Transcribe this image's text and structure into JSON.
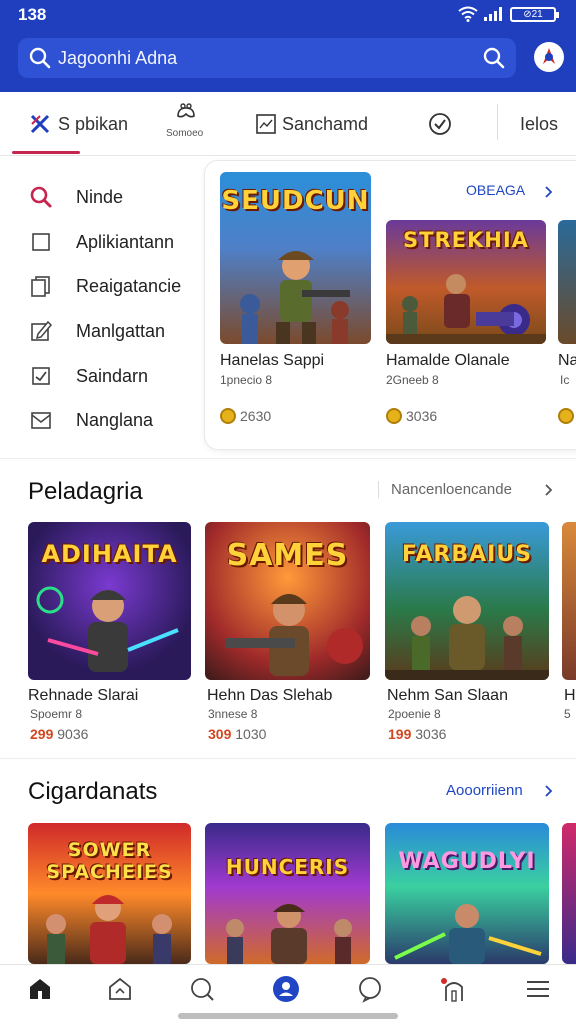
{
  "status_bar": {
    "time": "138",
    "battery": "⊘21"
  },
  "search": {
    "text": "Jagoonhi Adna",
    "left_icon": "search-icon",
    "right_icon": "search-icon"
  },
  "tabs": [
    {
      "label": "S pbikan",
      "icon": "close-x-icon",
      "active": true
    },
    {
      "label": "",
      "sublabel": "Somoeo",
      "icon": "controller-icon"
    },
    {
      "label": "Sanchamd",
      "icon": "image-icon"
    },
    {
      "label": "",
      "icon": "check-circle-icon"
    },
    {
      "label": "Ielos",
      "icon": ""
    }
  ],
  "sidebar": {
    "items": [
      {
        "label": "Ninde",
        "icon": "search-icon"
      },
      {
        "label": "Aplikiantann",
        "icon": "square-icon"
      },
      {
        "label": "Reaigatancie",
        "icon": "copy-icon"
      },
      {
        "label": "Manlgattan",
        "icon": "edit-icon"
      },
      {
        "label": "Saindarn",
        "icon": "check-square-icon"
      },
      {
        "label": "Nanglana",
        "icon": "mail-icon"
      }
    ]
  },
  "featured": {
    "link": "OBEAGA",
    "games": [
      {
        "art": "SEUDCUN",
        "name": "Hanelas Sappi",
        "sub": "1pnecio 8",
        "price": "2630"
      },
      {
        "art": "STREKHIA",
        "name": "Hamalde Olanale",
        "sub": "2Gneeb 8",
        "price": "3036"
      },
      {
        "art": "",
        "name": "Na",
        "sub": "Ic",
        "price": ""
      }
    ]
  },
  "section1": {
    "title": "Peladagria",
    "right": "Nancenloencande",
    "games": [
      {
        "art": "ADIHAITA",
        "name": "Rehnade Slarai",
        "sub": "Spoemr 8",
        "price_bold": "299",
        "price_rest": "9036"
      },
      {
        "art": "SAMES",
        "name": "Hehn Das Slehab",
        "sub": "3nnese 8",
        "price_bold": "309",
        "price_rest": "1030"
      },
      {
        "art": "FARBAIUS",
        "name": "Nehm San Slaan",
        "sub": "2poenie 8",
        "price_bold": "199",
        "price_rest": "3036"
      },
      {
        "art": "",
        "name": "H",
        "sub": "5",
        "price_bold": "",
        "price_rest": ""
      }
    ]
  },
  "section2": {
    "title": "Cigardanats",
    "right": "Aooorriienn",
    "games": [
      {
        "art": "SOWER SPACHEIES"
      },
      {
        "art": "HUNCERIS"
      },
      {
        "art": "WAGUDLYI"
      },
      {
        "art": ""
      }
    ]
  },
  "bottom_nav": [
    {
      "icon": "home-icon"
    },
    {
      "icon": "store-icon"
    },
    {
      "icon": "search-icon"
    },
    {
      "icon": "profile-icon",
      "active": true
    },
    {
      "icon": "chat-icon"
    },
    {
      "icon": "library-icon"
    },
    {
      "icon": "menu-icon"
    }
  ],
  "colors": {
    "header": "#1f3fbf",
    "search": "#2f52d4",
    "accent": "#2046c4",
    "active_tab": "#c7254e",
    "price": "#d2471f"
  }
}
